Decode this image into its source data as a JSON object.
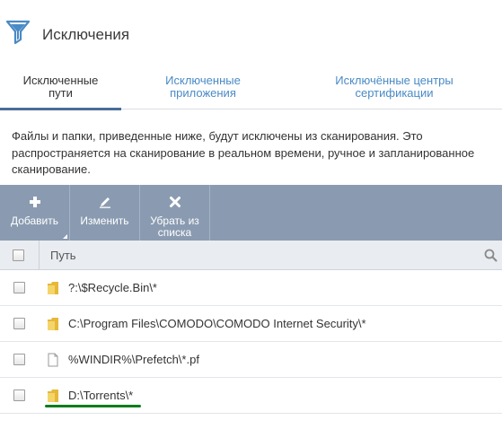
{
  "header": {
    "title": "Исключения",
    "icon": "filter-icon",
    "icon_color": "#4a8ac5"
  },
  "tabs": [
    {
      "line1": "Исключенные",
      "line2": "пути",
      "active": true
    },
    {
      "line1": "Исключенные",
      "line2": "приложения",
      "active": false
    },
    {
      "line1": "Исключённые центры",
      "line2": "сертификации",
      "active": false
    }
  ],
  "description": "Файлы и папки, приведенные ниже, будут исключены из сканирования. Это распространяется на сканирование в реальном времени, ручное и запланированное сканирование.",
  "toolbar": {
    "background": "#8a9bb1",
    "add": {
      "label": "Добавить",
      "icon": "plus-icon"
    },
    "edit": {
      "label": "Изменить",
      "icon": "pencil-icon"
    },
    "remove": {
      "line1": "Убрать из",
      "line2": "списка",
      "icon": "x-icon"
    }
  },
  "grid": {
    "column_path": "Путь",
    "rows": [
      {
        "type": "folder",
        "path": "?:\\$Recycle.Bin\\*"
      },
      {
        "type": "folder",
        "path": "C:\\Program Files\\COMODO\\COMODO Internet Security\\*"
      },
      {
        "type": "file",
        "path": "%WINDIR%\\Prefetch\\*.pf"
      },
      {
        "type": "folder",
        "path": "D:\\Torrents\\*"
      }
    ]
  },
  "highlight_color": "#0b7d1a"
}
